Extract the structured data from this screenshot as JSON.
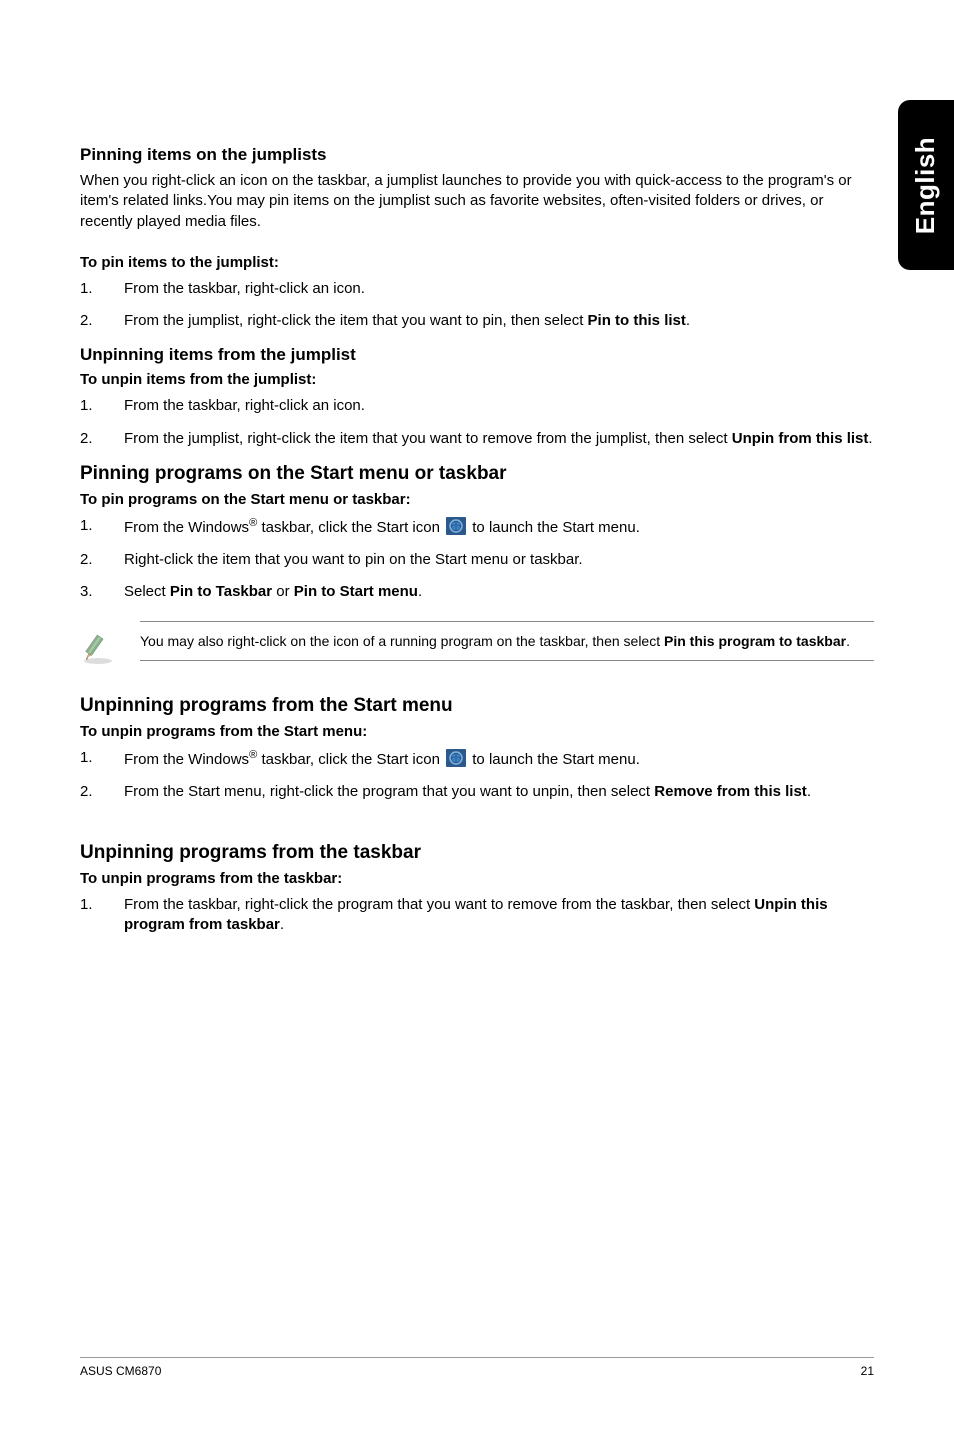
{
  "sideTab": "English",
  "s1": {
    "heading": "Pinning items on the jumplists",
    "intro": "When you right-click an icon on the taskbar, a jumplist launches to provide you with quick-access to the program's or item's related links.You may pin items on the jumplist such as favorite websites, often-visited folders or drives, or recently played media files.",
    "subhead": "To pin items to the jumplist:",
    "li1n": "1.",
    "li1": "From the taskbar, right-click an icon.",
    "li2n": "2.",
    "li2a": "From the jumplist, right-click the item that you want to pin, then select ",
    "li2b": "Pin to this list",
    "li2c": "."
  },
  "s2": {
    "heading": "Unpinning items from the jumplist",
    "subhead": "To unpin items from the jumplist:",
    "li1n": "1.",
    "li1": "From the taskbar, right-click an icon.",
    "li2n": "2.",
    "li2a": "From the jumplist, right-click the item that you want to remove from the jumplist, then select ",
    "li2b": "Unpin from this list",
    "li2c": "."
  },
  "s3": {
    "heading": "Pinning programs on the Start menu or taskbar",
    "subhead": "To pin programs on the Start menu or taskbar:",
    "li1n": "1.",
    "li1a": "From the Windows",
    "li1reg": "®",
    "li1b": " taskbar, click the Start icon ",
    "li1c": " to launch the Start menu.",
    "li2n": "2.",
    "li2": "Right-click the item that you want to pin on the Start menu or taskbar.",
    "li3n": "3.",
    "li3a": "Select ",
    "li3b": "Pin to Taskbar",
    "li3c": " or ",
    "li3d": "Pin to Start menu",
    "li3e": ".",
    "noteA": "You may also right-click on the icon of a running program on the taskbar, then select ",
    "noteB": "Pin this program to taskbar",
    "noteC": "."
  },
  "s4": {
    "heading": "Unpinning programs from the Start menu",
    "subhead": "To unpin programs from the Start menu:",
    "li1n": "1.",
    "li1a": "From the Windows",
    "li1reg": "®",
    "li1b": " taskbar, click the Start icon ",
    "li1c": " to launch the Start menu.",
    "li2n": "2.",
    "li2a": "From the Start menu, right-click the program that you want to unpin, then select ",
    "li2b": "Remove from this list",
    "li2c": "."
  },
  "s5": {
    "heading": "Unpinning programs from the taskbar",
    "subhead": "To unpin programs from the taskbar:",
    "li1n": "1.",
    "li1a": "From the taskbar, right-click the program that you want to remove from the taskbar, then select ",
    "li1b": "Unpin this program from taskbar",
    "li1c": "."
  },
  "footer": {
    "left": "ASUS CM6870",
    "right": "21"
  }
}
